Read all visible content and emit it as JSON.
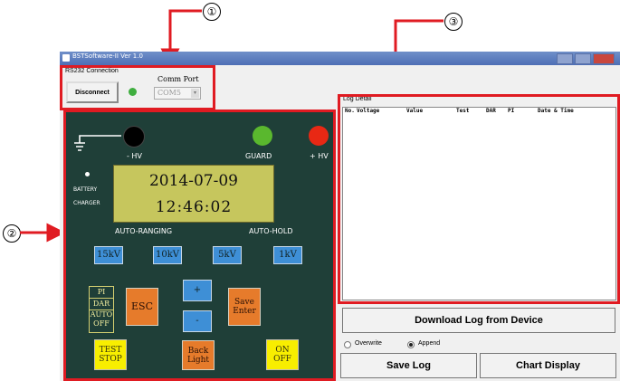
{
  "window": {
    "title": "BSTSoftware-II Ver 1.0"
  },
  "callouts": [
    "①",
    "②",
    "③"
  ],
  "connection": {
    "label": "RS232 Connection",
    "disconnect_label": "Disconnect",
    "comm_port_label": "Comm Port",
    "comm_port_value": "COM5",
    "status_color": "#3fae3f"
  },
  "device": {
    "hv_label": "- HV",
    "guard_label": "GUARD",
    "plus_hv_label": "+ HV",
    "battery_label": "BATTERY",
    "charger_label": "CHARGER",
    "date": "2014-07-09",
    "time": "12:46:02",
    "auto_ranging": "AUTO-RANGING",
    "auto_hold": "AUTO-HOLD",
    "voltage_buttons": [
      "15kV",
      "10kV",
      "5kV",
      "1kV"
    ],
    "modes": [
      "PI",
      "DAR",
      "AUTO",
      "OFF"
    ],
    "esc": "ESC",
    "up": "+",
    "down": "-",
    "save_enter": "Save\nEnter",
    "test_stop": "TEST\nSTOP",
    "back_light": "Back\nLight",
    "on_off": "ON\nOFF",
    "colors": {
      "guard": "#5ab82e",
      "plus_hv": "#e82814",
      "minus_hv": "#000000"
    }
  },
  "log": {
    "label": "Log Detail",
    "columns": [
      "No.",
      "Voltage",
      "Value",
      "Test",
      "DAR",
      "PI",
      "Date & Time"
    ],
    "rows": []
  },
  "actions": {
    "download": "Download Log from Device",
    "overwrite": "Overwrite",
    "append": "Append",
    "append_selected": true,
    "save_log": "Save Log",
    "chart_display": "Chart Display"
  }
}
